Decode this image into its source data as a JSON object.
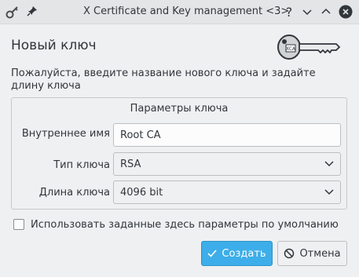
{
  "window": {
    "title": "X Certificate and Key management <3>",
    "help_glyph": "?",
    "icons": [
      "app-key-icon",
      "pin-icon",
      "help-icon",
      "minimize-icon",
      "maximize-icon",
      "close-icon"
    ]
  },
  "header": {
    "title": "Новый ключ"
  },
  "description": "Пожалуйста, введите название нового ключа и задайте длину ключа",
  "group": {
    "title": "Параметры ключа",
    "fields": [
      {
        "label": "Внутреннее имя",
        "value": "Root CA"
      },
      {
        "label": "Тип ключа",
        "value": "RSA"
      },
      {
        "label": "Длина ключа",
        "value": "4096 bit"
      }
    ]
  },
  "checkbox": {
    "label": "Использовать заданные здесь параметры по умолчанию",
    "checked": false
  },
  "buttons": {
    "create": "Создать",
    "cancel": "Отмена"
  },
  "colors": {
    "accent": "#3daee9",
    "background": "#eff0f1",
    "text": "#31363b"
  }
}
